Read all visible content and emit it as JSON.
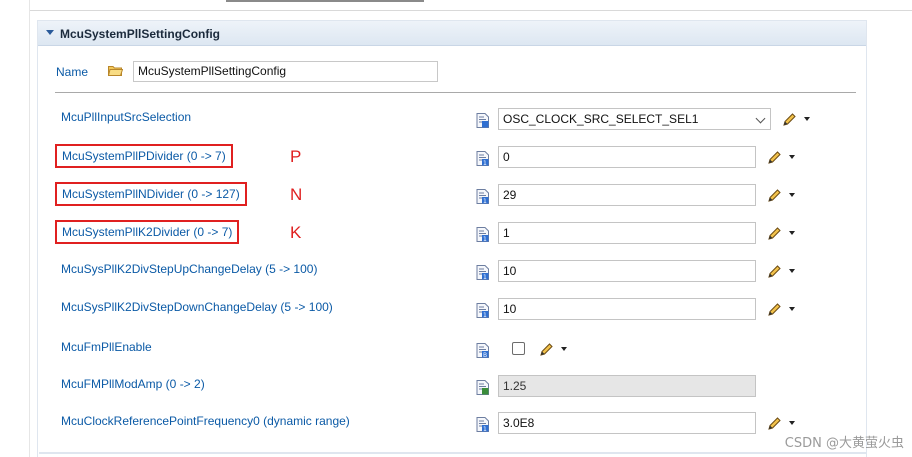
{
  "section": {
    "title": "McuSystemPllSettingConfig"
  },
  "name": {
    "label": "Name",
    "value": "McuSystemPllSettingConfig"
  },
  "params": [
    {
      "label": "McuPllInputSrcSelection",
      "kind": "select",
      "value": "OSC_CLOCK_SRC_SELECT_SEL1",
      "highlight": false,
      "marker": ""
    },
    {
      "label": "McuSystemPllPDivider (0 -> 7)",
      "kind": "text",
      "value": "0",
      "highlight": true,
      "marker": "P"
    },
    {
      "label": "McuSystemPllNDivider (0 -> 127)",
      "kind": "text",
      "value": "29",
      "highlight": true,
      "marker": "N"
    },
    {
      "label": "McuSystemPllK2Divider (0 -> 7)",
      "kind": "text",
      "value": "1",
      "highlight": true,
      "marker": "K"
    },
    {
      "label": "McuSysPllK2DivStepUpChangeDelay (5 -> 100)",
      "kind": "text",
      "value": "10",
      "highlight": false,
      "marker": ""
    },
    {
      "label": "McuSysPllK2DivStepDownChangeDelay (5 -> 100)",
      "kind": "text",
      "value": "10",
      "highlight": false,
      "marker": ""
    },
    {
      "label": "McuFmPllEnable",
      "kind": "checkbox",
      "value": "",
      "checked": false,
      "highlight": false,
      "marker": ""
    },
    {
      "label": "McuFMPllModAmp (0 -> 2)",
      "kind": "readonly",
      "value": "1.25",
      "highlight": false,
      "marker": ""
    },
    {
      "label": "McuClockReferencePointFrequency0 (dynamic range)",
      "kind": "text",
      "value": "3.0E8",
      "highlight": false,
      "marker": ""
    }
  ],
  "watermark": "CSDN @大黄萤火虫",
  "colors": {
    "link": "#0b5aa6",
    "highlight": "#e02020",
    "header_bg": "#dde7f2"
  }
}
